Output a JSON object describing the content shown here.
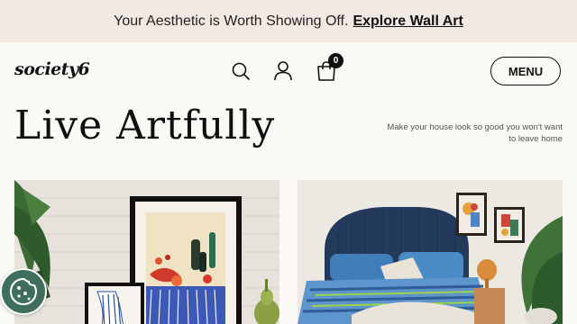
{
  "promo": {
    "text": "Your Aesthetic is Worth Showing Off.",
    "link_label": "Explore Wall Art"
  },
  "header": {
    "logo": "society6",
    "cart_count": "0",
    "menu_label": "MENU",
    "icons": [
      "search-icon",
      "account-icon",
      "cart-icon"
    ]
  },
  "hero": {
    "title": "Live Artfully",
    "tagline": "Make your house look so good you won't want to leave home"
  },
  "cards": [
    {
      "name": "wall-art-scene"
    },
    {
      "name": "bedroom-scene"
    }
  ],
  "colors": {
    "promo_bg": "#f3e9e3",
    "page_bg": "#fbf9f6",
    "cookie_bg": "#3f6f5c"
  }
}
